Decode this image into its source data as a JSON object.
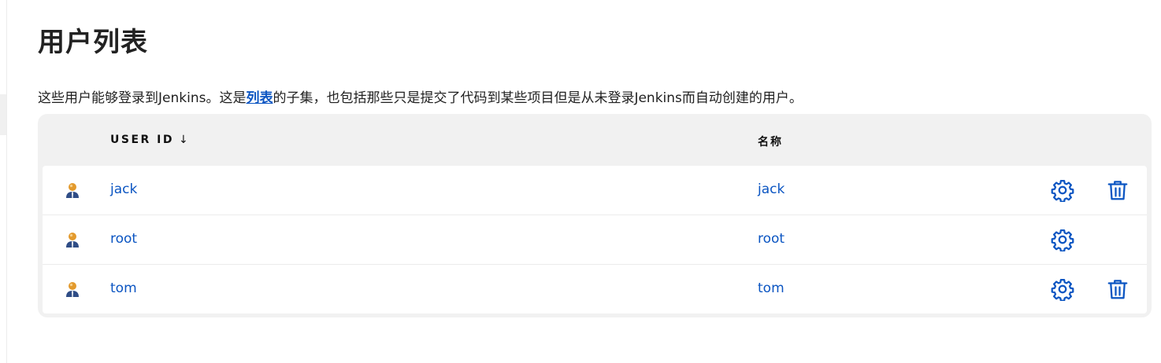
{
  "page": {
    "title": "用户列表",
    "description_before": "这些用户能够登录到Jenkins。这是",
    "description_link": "列表",
    "description_after": "的子集，也包括那些只是提交了代码到某些项目但是从未登录Jenkins而自动创建的用户。"
  },
  "table": {
    "columns": {
      "user_id": "USER ID",
      "sort_indicator": "↓",
      "name": "名称"
    },
    "rows": [
      {
        "user_id": "jack",
        "name": "jack",
        "has_delete": true
      },
      {
        "user_id": "root",
        "name": "root",
        "has_delete": false
      },
      {
        "user_id": "tom",
        "name": "tom",
        "has_delete": true
      }
    ]
  },
  "icons": {
    "avatar": "user-avatar-icon",
    "configure": "gear-icon",
    "delete": "trash-icon"
  },
  "colors": {
    "link": "#0b55c2",
    "table_header_bg": "#f1f1f1",
    "text": "#1f1f1f"
  }
}
